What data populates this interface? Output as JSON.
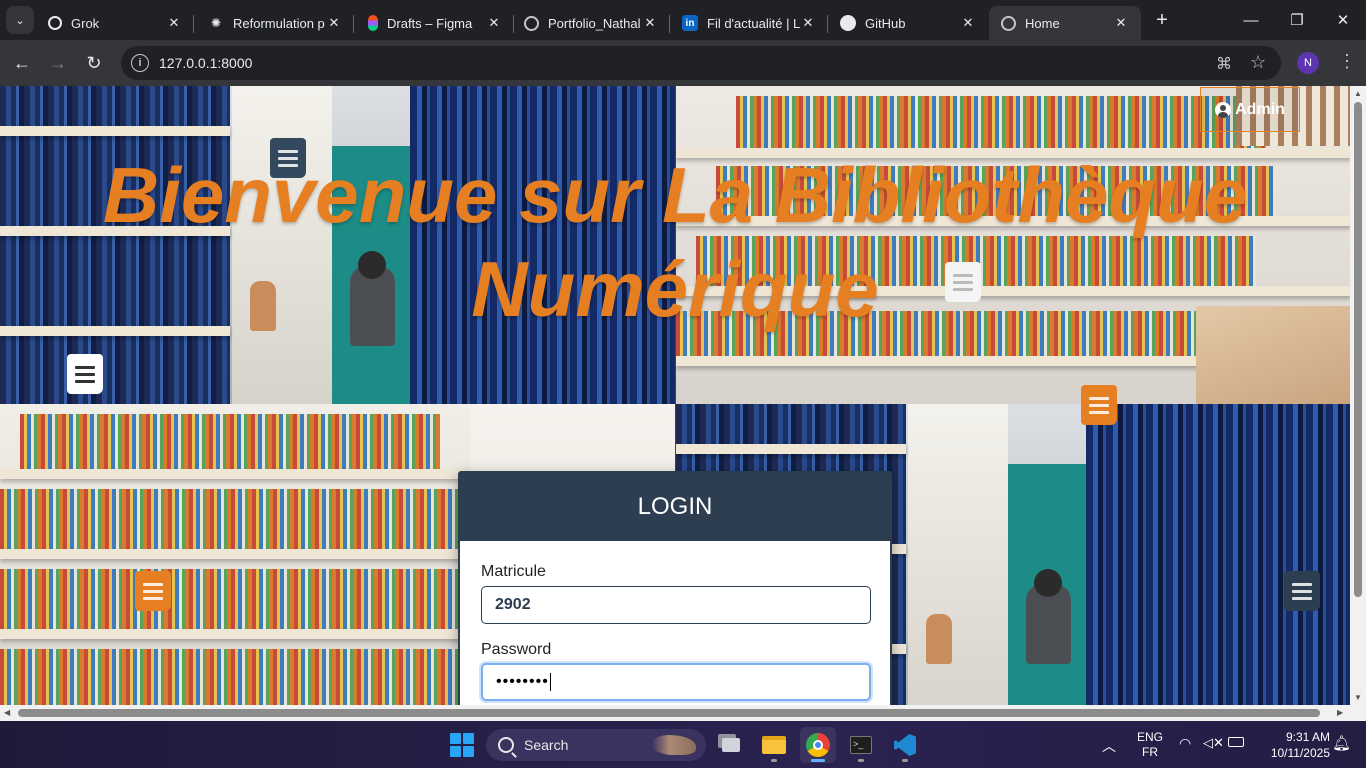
{
  "browser": {
    "tabs": [
      {
        "title": "Grok",
        "icon": "grok-icon"
      },
      {
        "title": "Reformulation p",
        "icon": "openai-icon"
      },
      {
        "title": "Drafts – Figma",
        "icon": "figma-icon"
      },
      {
        "title": "Portfolio_Nathal",
        "icon": "globe-icon"
      },
      {
        "title": "Fil d'actualité | Li",
        "icon": "linkedin-icon"
      },
      {
        "title": "GitHub",
        "icon": "github-icon"
      },
      {
        "title": "Home",
        "icon": "globe-icon",
        "active": true
      }
    ],
    "url": "127.0.0.1:8000",
    "profile_initial": "N"
  },
  "page": {
    "hero_title": "Bienvenue sur La Bibliothèque Numérique",
    "admin_label": "Admin",
    "accent_color": "#e67e22",
    "header_color": "#2c3e50",
    "login": {
      "title": "LOGIN",
      "matricule_label": "Matricule",
      "matricule_value": "2902",
      "password_label": "Password",
      "password_value": "••••••••"
    }
  },
  "taskbar": {
    "search_label": "Search",
    "lang_top": "ENG",
    "lang_bottom": "FR",
    "time": "9:31 AM",
    "date": "10/11/2025"
  }
}
